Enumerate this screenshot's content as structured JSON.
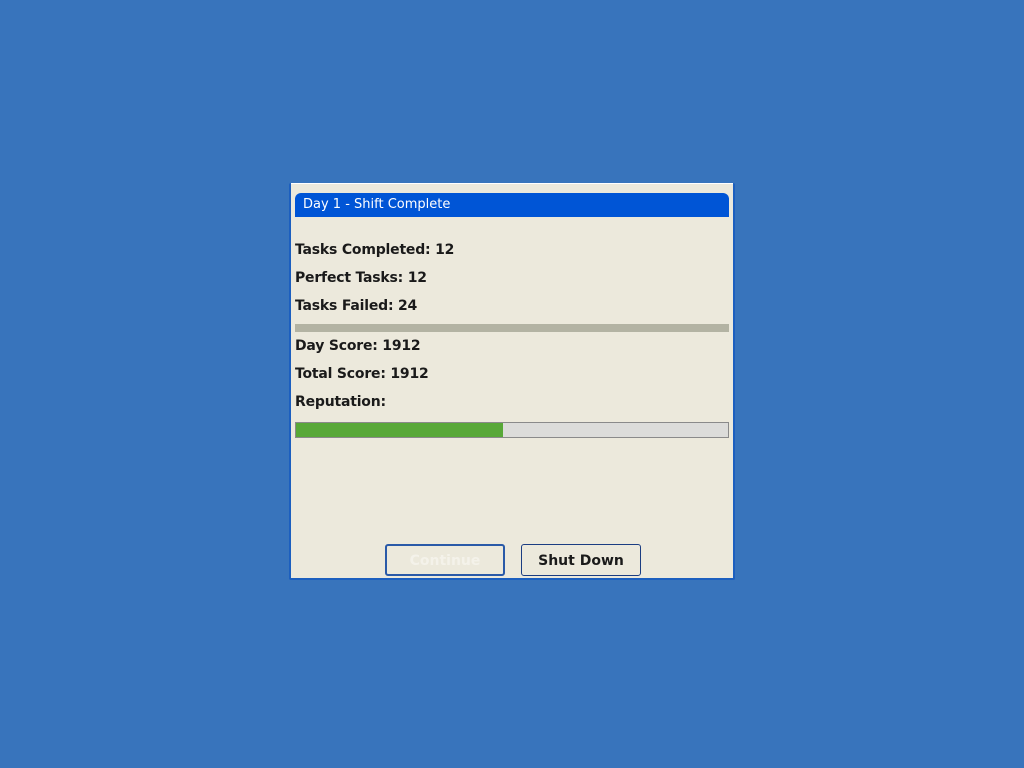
{
  "dialog": {
    "title": "Day 1 - Shift Complete"
  },
  "stats": {
    "tasks_completed": "Tasks Completed: 12",
    "perfect_tasks": "Perfect Tasks: 12",
    "tasks_failed": "Tasks Failed: 24",
    "day_score": "Day Score: 1912",
    "total_score": "Total Score: 1912",
    "reputation_label": "Reputation:"
  },
  "reputation": {
    "fraction": 0.48,
    "fill_color": "#58a838"
  },
  "buttons": {
    "continue_label": "Continue",
    "continue_disabled": true,
    "shutdown_label": "Shut Down"
  },
  "colors": {
    "desktop": "#3874bc",
    "titlebar": "#0055d6",
    "dialog_bg": "#ece9dc"
  }
}
